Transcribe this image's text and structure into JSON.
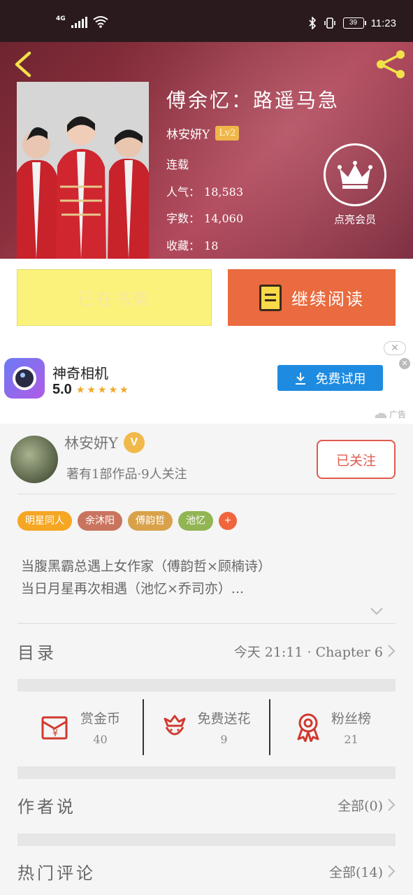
{
  "status_bar": {
    "network": "4G",
    "battery": "39",
    "time": "11:23"
  },
  "book": {
    "title": "傅余忆：路遥马急",
    "author": "林安妍Y",
    "level": "Lv2",
    "status": "连载",
    "popularity_label": "人气：",
    "popularity": "18,583",
    "words_label": "字数：",
    "words": "14,060",
    "favorites_label": "收藏：",
    "favorites": "18",
    "member_label": "点亮会员"
  },
  "actions": {
    "shelf_label": "已在书架",
    "read_label": "继续阅读"
  },
  "ad": {
    "app_name": "神奇相机",
    "score": "5.0",
    "stars": "★★★★★",
    "cta": "免费试用",
    "close": "✕",
    "tag": "广告"
  },
  "author": {
    "name": "林安妍Y",
    "badge": "V",
    "summary": "著有1部作品·9人关注",
    "follow_label": "已关注"
  },
  "tags": [
    {
      "label": "明星同人",
      "color": "#f5a623"
    },
    {
      "label": "余沐阳",
      "color": "#c9745f"
    },
    {
      "label": "傅韵哲",
      "color": "#d9a24a"
    },
    {
      "label": "池忆",
      "color": "#92b554"
    },
    {
      "label": "+",
      "color": "#f0653d"
    }
  ],
  "description": {
    "line1": "当腹黑霸总遇上女作家（傅韵哲×顾楠诗）",
    "line2": "当日月星再次相遇（池忆×乔司亦）..."
  },
  "catalog": {
    "title": "目录",
    "latest": "今天 21:11 · Chapter 6"
  },
  "stats": [
    {
      "label": "赏金币",
      "value": "40",
      "icon": "red-envelope-icon"
    },
    {
      "label": "免费送花",
      "value": "9",
      "icon": "flower-icon"
    },
    {
      "label": "粉丝榜",
      "value": "21",
      "icon": "award-ribbon-icon"
    }
  ],
  "author_notes": {
    "title": "作者说",
    "count": "全部(0)"
  },
  "comments": {
    "title": "热门评论",
    "count": "全部(14)"
  },
  "colors": {
    "accent_orange": "#ea6b3f",
    "shelf_yellow": "#fbf27c",
    "icon_yellow": "#f2e24a",
    "follow_red": "#e05a4e",
    "ad_blue": "#1e8be0"
  }
}
